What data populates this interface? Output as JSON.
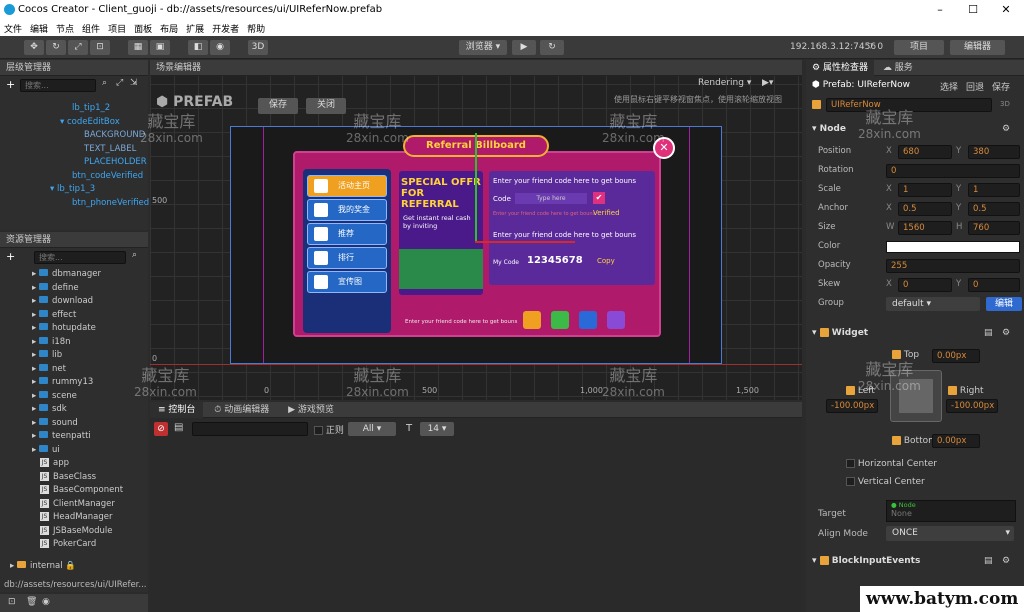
{
  "window": {
    "title": "Cocos Creator - Client_guoji - db://assets/resources/ui/UIReferNow.prefab",
    "min": "–",
    "max": "☐",
    "close": "✕"
  },
  "menu": [
    "文件",
    "编辑",
    "节点",
    "组件",
    "项目",
    "面板",
    "布局",
    "扩展",
    "开发者",
    "帮助"
  ],
  "toolbar": {
    "mode3d": "3D",
    "browser": "浏览器 ▾",
    "play": "▶",
    "refresh": "↻",
    "ip": "192.168.3.12:7456",
    "project": "项目",
    "editor": "编辑器"
  },
  "hierarchy": {
    "title": "层级管理器",
    "search": "搜索...",
    "items": [
      {
        "label": "lb_tip1_2",
        "indent": 1
      },
      {
        "label": "codeEditBox",
        "indent": 0
      },
      {
        "label": "BACKGROUND",
        "indent": 2
      },
      {
        "label": "TEXT_LABEL",
        "indent": 2
      },
      {
        "label": "PLACEHOLDER",
        "indent": 2
      },
      {
        "label": "btn_codeVerified",
        "indent": 1
      },
      {
        "label": "lb_tip1_3",
        "indent": 0
      },
      {
        "label": "btn_phoneVerified",
        "indent": 1
      }
    ]
  },
  "assets": {
    "title": "资源管理器",
    "search": "搜索...",
    "folders": [
      "dbmanager",
      "define",
      "download",
      "effect",
      "hotupdate",
      "i18n",
      "lib",
      "net",
      "rummy13",
      "scene",
      "sdk",
      "sound",
      "teenpatti",
      "ui"
    ],
    "scripts": [
      "app",
      "BaseClass",
      "BaseComponent",
      "ClientManager",
      "HeadManager",
      "JSBaseModule",
      "PokerCard"
    ],
    "internal": "internal",
    "path": "db://assets/resources/ui/UIRefer..."
  },
  "scene": {
    "title": "场景编辑器",
    "prefab_label": "PREFAB",
    "save": "保存",
    "close": "关闭",
    "rendering": "Rendering ▾",
    "hint": "使用鼠标右键平移视窗焦点，使用滚轮缩放视图",
    "axis_y": [
      "500",
      "0"
    ],
    "axis_x": [
      "0",
      "500",
      "1,000",
      "1,500"
    ]
  },
  "game": {
    "board_title": "Referral Billboard",
    "menu": [
      "活动主页",
      "我的奖金",
      "推荐",
      "排行",
      "宣传图"
    ],
    "promo1": "SPECIAL OFFR",
    "promo2": "FOR REFERRAL",
    "promo3": "Get instant real cash by inviting",
    "enter_code": "Enter your friend code here to get bouns",
    "code_label": "Code",
    "type_here": "Type here",
    "verified_hint": "Enter your friend code here to get bouns",
    "verified": "Verified",
    "enter_code2": "Enter your friend code here to get bouns",
    "my_code_label": "My Code",
    "my_code": "12345678",
    "copy": "Copy",
    "bottom_tip": "Enter your friend code here to get bouns",
    "close": "✕"
  },
  "console": {
    "tabs": [
      "控制台",
      "动画编辑器",
      "游戏预览"
    ],
    "regex": "正则",
    "level": "All",
    "fontsize": "14"
  },
  "inspector": {
    "tabs": [
      "属性检查器",
      "服务"
    ],
    "prefab": "Prefab:",
    "prefab_name": "UIReferNow",
    "select": "选择",
    "revert": "回退",
    "save": "保存",
    "node_name": "UIReferNow",
    "badge3d": "3D",
    "node": "Node",
    "props": [
      {
        "label": "Position",
        "x": "680",
        "y": "380"
      },
      {
        "label": "Rotation",
        "v": "0"
      },
      {
        "label": "Scale",
        "x": "1",
        "y": "1"
      },
      {
        "label": "Anchor",
        "x": "0.5",
        "y": "0.5"
      },
      {
        "label": "Size",
        "x": "1560",
        "y": "760",
        "xl": "W",
        "yl": "H"
      },
      {
        "label": "Color"
      },
      {
        "label": "Opacity",
        "v": "255"
      },
      {
        "label": "Skew",
        "x": "0",
        "y": "0"
      },
      {
        "label": "Group",
        "v": "default"
      }
    ],
    "edit": "编辑",
    "widget": "Widget",
    "top": "Top",
    "top_v": "0.00px",
    "left": "Left",
    "left_v": "-100.00px",
    "right": "Right",
    "right_v": "-100.00px",
    "bottom": "Bottom",
    "bottom_v": "0.00px",
    "hcenter": "Horizontal Center",
    "vcenter": "Vertical Center",
    "target": "Target",
    "target_type": "Node",
    "target_v": "None",
    "align_mode": "Align Mode",
    "align_v": "ONCE",
    "block": "BlockInputEvents"
  },
  "watermarks": [
    {
      "cn": "藏宝库",
      "en": "28xin.com"
    }
  ],
  "footer_site": "www.batym.com"
}
